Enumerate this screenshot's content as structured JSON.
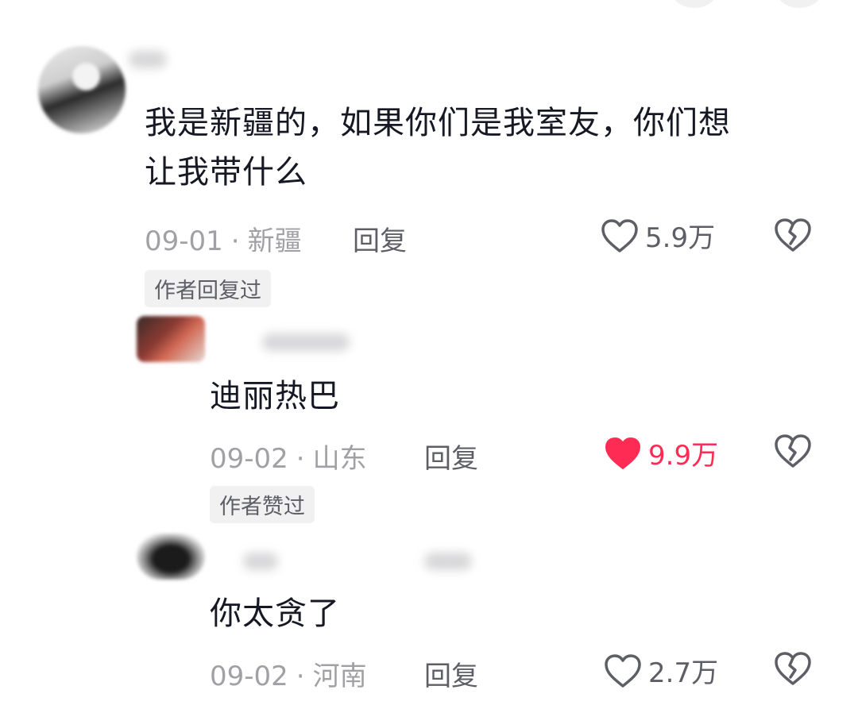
{
  "comment": {
    "text": "我是新疆的，如果你们是我室友，你们想\n让我带什么",
    "date": "09-01",
    "location": "新疆",
    "reply_label": "回复",
    "likes": "5.9万",
    "liked": false,
    "tag": "作者回复过"
  },
  "replies": [
    {
      "text": "迪丽热巴",
      "date": "09-02",
      "location": "山东",
      "reply_label": "回复",
      "likes": "9.9万",
      "liked": true,
      "tag": "作者赞过"
    },
    {
      "text": "你太贪了",
      "date": "09-02",
      "location": "河南",
      "reply_label": "回复",
      "likes": "2.7万",
      "liked": false
    }
  ],
  "colors": {
    "like_active": "#fe2c55",
    "meta_gray": "#a1a1a5",
    "text": "#161823"
  },
  "icons": {
    "like": "heart-icon",
    "dislike": "broken-heart-icon"
  }
}
